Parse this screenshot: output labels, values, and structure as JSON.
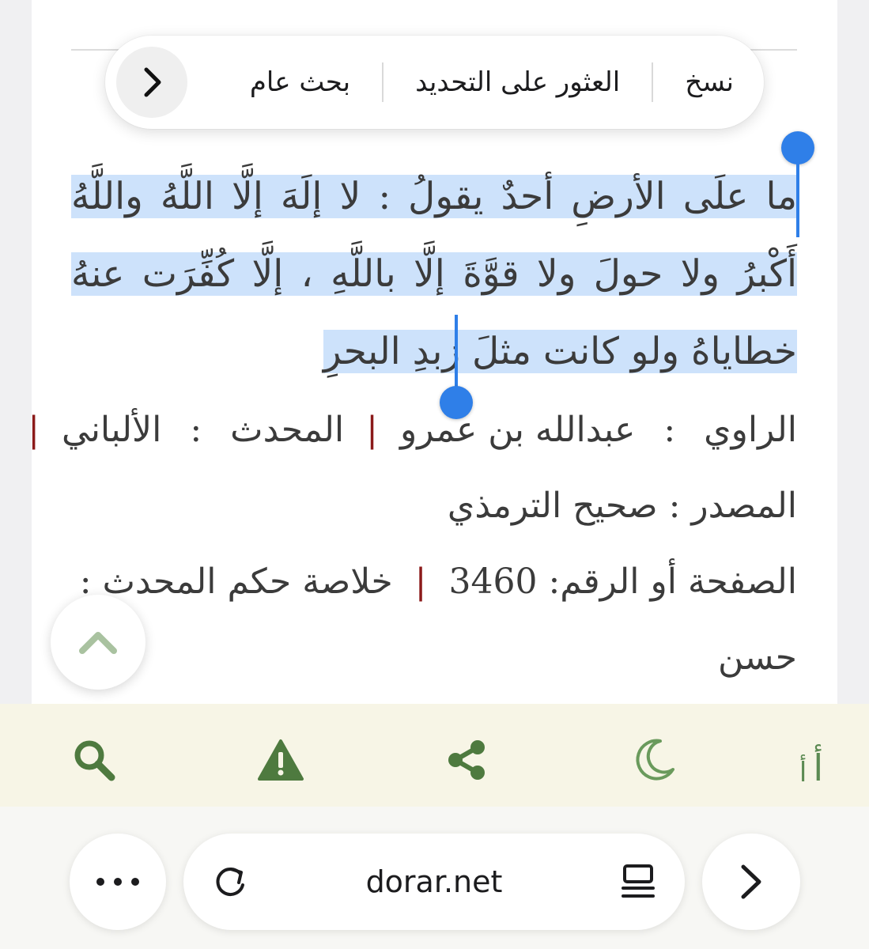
{
  "context_menu": {
    "copy": "نسخ",
    "find_selection": "العثور على التحديد",
    "general_search": "بحث عام",
    "next_icon": "chevron-right-icon"
  },
  "hadith": {
    "selected_text": "ما علَى الأرضِ أحدٌ يقولُ : لا إلَهَ إلَّا اللَّهُ واللَّهُ أَكْبرُ ولا حولَ ولا قوَّةَ إلَّا باللَّهِ ، إلَّا كُفِّرَت عنهُ خطاياهُ ولو كانت مثلَ زبدِ البحرِ"
  },
  "meta": {
    "narrator_label": "الراوي",
    "narrator_value": "عبدالله بن عمرو",
    "muhaddith_label": "المحدث",
    "muhaddith_value": "الألباني",
    "source_label": "المصدر",
    "source_value": "صحيح الترمذي",
    "page_label": "الصفحة أو الرقم:",
    "page_value": "3460",
    "ruling_label": "خلاصة حكم المحدث :",
    "ruling_value": "حسن",
    "separator": "|",
    "colon": ":"
  },
  "toolbar": {
    "font_size_big": "أ",
    "font_size_small": "أ",
    "icons": [
      "font-size-icon",
      "moon-icon",
      "share-icon",
      "warning-icon",
      "search-icon"
    ]
  },
  "browser": {
    "url": "dorar.net",
    "more_icon": "more-dots-icon",
    "reload_icon": "reload-icon",
    "reader_icon": "reader-mode-icon",
    "forward_icon": "chevron-right-icon"
  },
  "colors": {
    "selection": "#cde2fb",
    "handle": "#2f7fe8",
    "separator_bar": "#8b1a1a",
    "toolbar_icon": "#4e7a3f",
    "toolbar_bg": "#f7f5e6"
  }
}
